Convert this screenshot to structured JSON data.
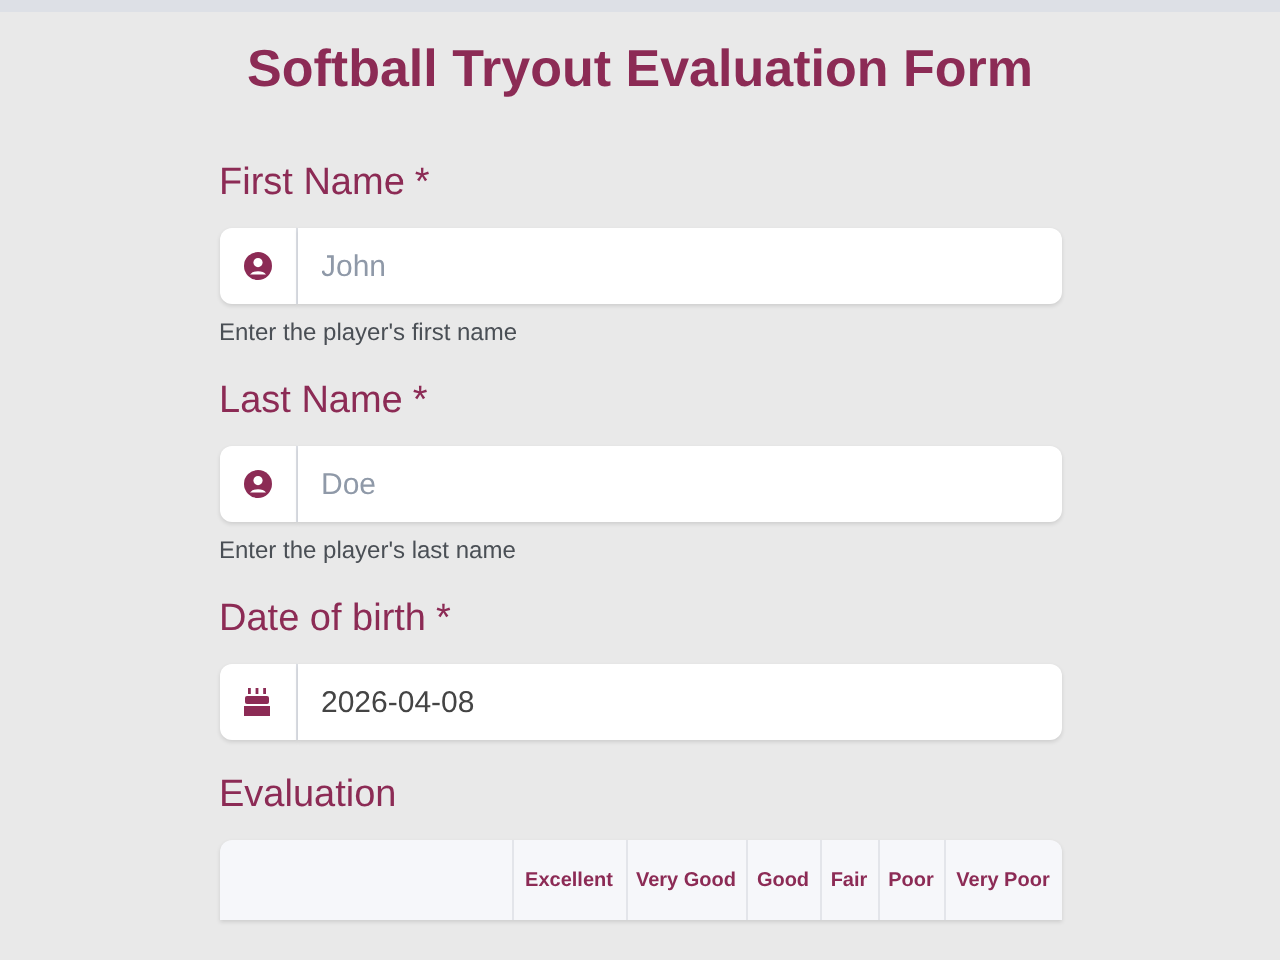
{
  "title": "Softball Tryout Evaluation Form",
  "fields": [
    {
      "label": "First Name",
      "required_mark": "*",
      "kind": "name",
      "placeholder": "John",
      "help": "Enter the player's first name"
    },
    {
      "label": "Last Name",
      "required_mark": "*",
      "kind": "name",
      "placeholder": "Doe",
      "help": "Enter the player's last name"
    },
    {
      "label": "Date of birth",
      "required_mark": "*",
      "kind": "date",
      "value": "2026-04-08"
    }
  ],
  "evaluation": {
    "label": "Evaluation",
    "columns": [
      "Excellent",
      "Very Good",
      "Good",
      "Fair",
      "Poor",
      "Very Poor"
    ]
  }
}
